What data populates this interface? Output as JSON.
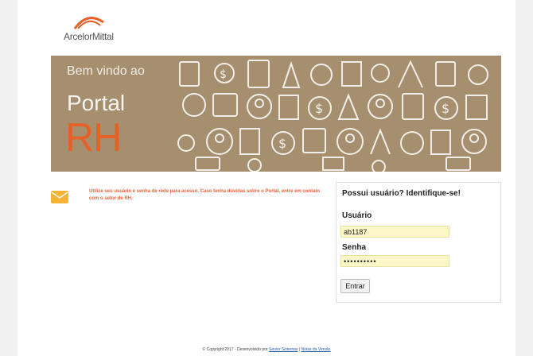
{
  "logo": {
    "brand": "ArcelorMittal"
  },
  "banner": {
    "welcome": "Bem vindo ao",
    "portal": "Portal",
    "rh": "RH"
  },
  "notice": {
    "text": "Utilize seu usuário e senha de rede para acesso. Caso tenha dúvidas sobre o Portal, entre em contato com o setor de RH."
  },
  "login": {
    "title": "Possui usuário? Identifique-se!",
    "user_label": "Usuário",
    "user_value": "ab1187",
    "password_label": "Senha",
    "password_value": "••••••••••",
    "submit": "Entrar"
  },
  "footer": {
    "text": "© Copyright 2017 - Desenvolvido por",
    "link1": "Senior Sistemas",
    "separator": "|",
    "link2": "Notas da Versão"
  },
  "colors": {
    "banner": "#a58f6e",
    "accent": "#e76025",
    "input_bg": "#fbf7c8",
    "link": "#2d5aa5"
  }
}
